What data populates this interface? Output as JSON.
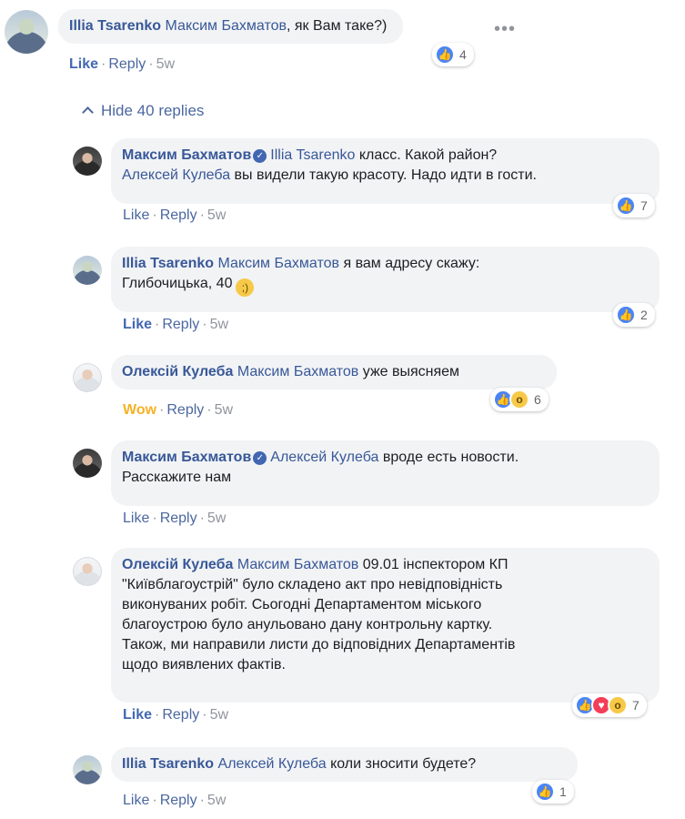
{
  "top_comment": {
    "author": "Illia Tsarenko",
    "mention": "Максим Бахматов",
    "text": ", як Вам таке?)",
    "actions": {
      "like": "Like",
      "reply": "Reply",
      "time": "5w"
    },
    "reaction_count": "4"
  },
  "hide_replies": {
    "label": "Hide 40 replies"
  },
  "replies": [
    {
      "author": "Максим Бахматов",
      "verified": true,
      "mention": "Illia Tsarenko",
      "line1": "класс. Какой район?",
      "mention2": "Алексей Кулеба",
      "line2": "вы видели такую красоту. Надо идти в гости.",
      "actions": {
        "like": "Like",
        "reply": "Reply",
        "time": "5w"
      },
      "reaction_count": "7"
    },
    {
      "author": "Illia Tsarenko",
      "mention": "Максим Бахматов",
      "line1": "я вам адресу скажу:",
      "line2": "Глибочицька, 40",
      "actions": {
        "like": "Like",
        "reply": "Reply",
        "time": "5w"
      },
      "reaction_count": "2"
    },
    {
      "author": "Олексій Кулеба",
      "mention": "Максим Бахматов",
      "line1": "уже выясняем",
      "actions": {
        "like": "Wow",
        "reply": "Reply",
        "time": "5w"
      },
      "reaction_count": "6"
    },
    {
      "author": "Максим Бахматов",
      "verified": true,
      "mention": "Алексей Кулеба",
      "line1": "вроде есть новости.",
      "line2": "Расскажите нам",
      "actions": {
        "like": "Like",
        "reply": "Reply",
        "time": "5w"
      }
    },
    {
      "author": "Олексій Кулеба",
      "mention": "Максим Бахматов",
      "line1": "09.01 інспектором КП",
      "line2": "\"Київблагоустрій\" було складено акт про невідповідність",
      "line3": "виконуваних робіт. Сьогодні Департаментом міського",
      "line4": "благоустрою було анульовано дану контрольну картку.",
      "line5": "Також, ми направили листи до відповідних Департаментів",
      "line6": "щодо виявлених фактів.",
      "actions": {
        "like": "Like",
        "reply": "Reply",
        "time": "5w"
      },
      "reaction_count": "7"
    },
    {
      "author": "Illia Tsarenko",
      "mention": "Алексей Кулеба",
      "line1": "коли зносити будете?",
      "actions": {
        "like": "Like",
        "reply": "Reply",
        "time": "5w"
      },
      "reaction_count": "1"
    }
  ],
  "colors": {
    "link": "#385898",
    "bubble": "#f2f3f5",
    "meta": "#90949c",
    "like_blue": "#4267b2",
    "wow_yellow": "#f7b125"
  },
  "icons": [
    "more-options-icon",
    "chevron-up-icon",
    "verified-badge-icon",
    "like-reaction-icon",
    "love-reaction-icon",
    "wow-reaction-icon",
    "wink-emoji-icon"
  ]
}
